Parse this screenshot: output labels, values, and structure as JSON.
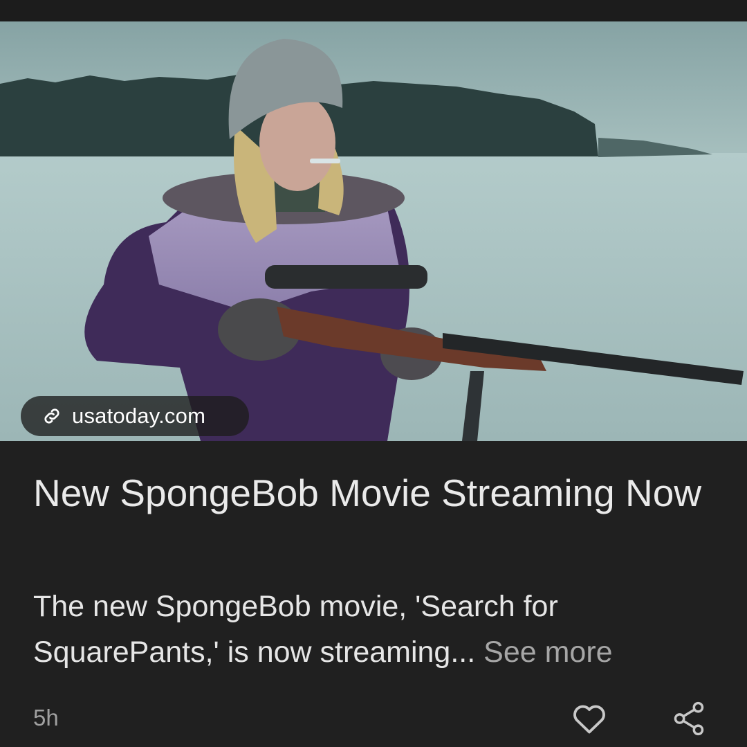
{
  "card": {
    "source": "usatoday.com",
    "headline": "New SpongeBob Movie Streaming Now",
    "summary": "The new SpongeBob movie, 'Search for SquarePants,' is now streaming...",
    "see_more": "See more",
    "time_ago": "5h"
  },
  "icons": {
    "source_link": "link-icon",
    "like": "heart-icon",
    "share": "share-icon"
  },
  "colors": {
    "background": "#202020",
    "headline": "#eaeaea",
    "muted": "#a6a6a6"
  }
}
